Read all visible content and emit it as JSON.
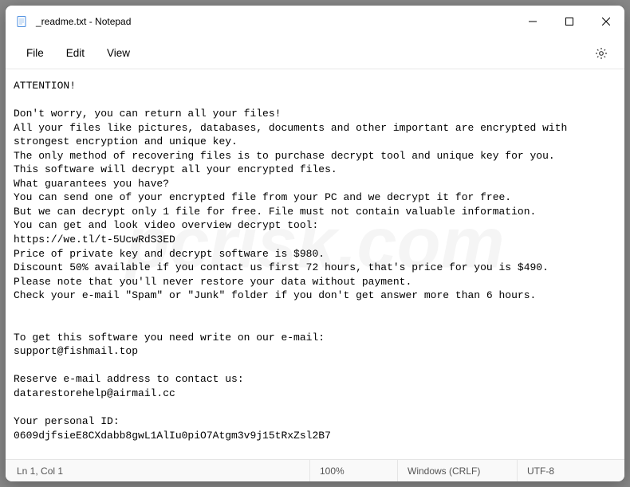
{
  "titlebar": {
    "title": "_readme.txt - Notepad"
  },
  "menubar": {
    "file": "File",
    "edit": "Edit",
    "view": "View"
  },
  "content": {
    "text": "ATTENTION!\n\nDon't worry, you can return all your files!\nAll your files like pictures, databases, documents and other important are encrypted with strongest encryption and unique key.\nThe only method of recovering files is to purchase decrypt tool and unique key for you.\nThis software will decrypt all your encrypted files.\nWhat guarantees you have?\nYou can send one of your encrypted file from your PC and we decrypt it for free.\nBut we can decrypt only 1 file for free. File must not contain valuable information.\nYou can get and look video overview decrypt tool:\nhttps://we.tl/t-5UcwRdS3ED\nPrice of private key and decrypt software is $980.\nDiscount 50% available if you contact us first 72 hours, that's price for you is $490.\nPlease note that you'll never restore your data without payment.\nCheck your e-mail \"Spam\" or \"Junk\" folder if you don't get answer more than 6 hours.\n\n\nTo get this software you need write on our e-mail:\nsupport@fishmail.top\n\nReserve e-mail address to contact us:\ndatarestorehelp@airmail.cc\n\nYour personal ID:\n0609djfsieE8CXdabb8gwL1AlIu0piO7Atgm3v9j15tRxZsl2B7"
  },
  "statusbar": {
    "position": "Ln 1, Col 1",
    "zoom": "100%",
    "line_ending": "Windows (CRLF)",
    "encoding": "UTF-8"
  },
  "watermark": "pcrisk.com"
}
